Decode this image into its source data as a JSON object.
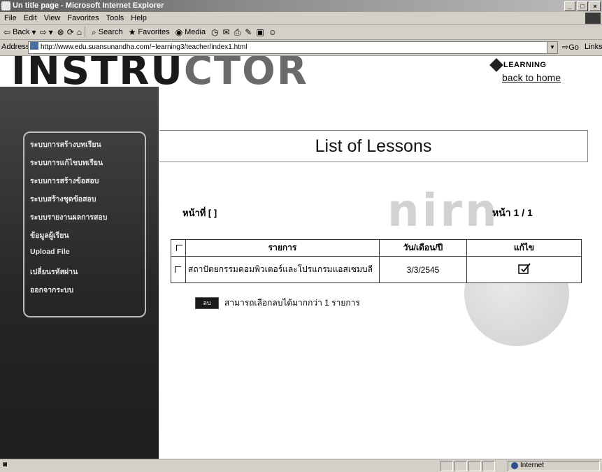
{
  "window": {
    "title": "Un title page - Microsoft Internet Explorer",
    "controls": [
      "_",
      "□",
      "×"
    ]
  },
  "menubar": [
    "File",
    "Edit",
    "View",
    "Favorites",
    "Tools",
    "Help"
  ],
  "toolbar": {
    "back": "Back",
    "search": "Search",
    "favorites": "Favorites",
    "media": "Media"
  },
  "addressbar": {
    "label": "Address",
    "url": "http://www.edu.suansunandha.com/~learning3/teacher/index1.html",
    "go": "Go",
    "links": "Links"
  },
  "page": {
    "logo_dark": "INSTRU",
    "logo_light": "CTOR",
    "brand_badge": "LEARNING",
    "back_home": "back to home",
    "sidebar_menu": [
      "ระบบการสร้างบทเรียน",
      "ระบบการแก้ไขบทเรียน",
      "ระบบการสร้างข้อสอบ",
      "ระบบสร้างชุดข้อสอบ",
      "ระบบรายงานผลการสอบ",
      "ข้อมูลผู้เรียน",
      "Upload File",
      "เปลี่ยนรหัสผ่าน",
      "ออกจากระบบ"
    ],
    "heading": "List of Lessons",
    "page_indicator_left": "หน้าที่ [ ]",
    "page_indicator_right": "หน้า 1 / 1",
    "table": {
      "headers": [
        "รายการ",
        "วัน/เดือน/ปี",
        "แก้ไข"
      ],
      "rows": [
        {
          "title": "สถาปัตยกรรมคอมพิวเตอร์และโปรแกรมแอสเซมบลี",
          "date": "3/3/2545",
          "edit_icon": "edit-icon"
        }
      ]
    },
    "delete_button": "ลบ",
    "delete_hint": "สามารถเลือกลบได้มากกว่า 1 รายการ"
  },
  "statusbar": {
    "zone": "Internet"
  }
}
